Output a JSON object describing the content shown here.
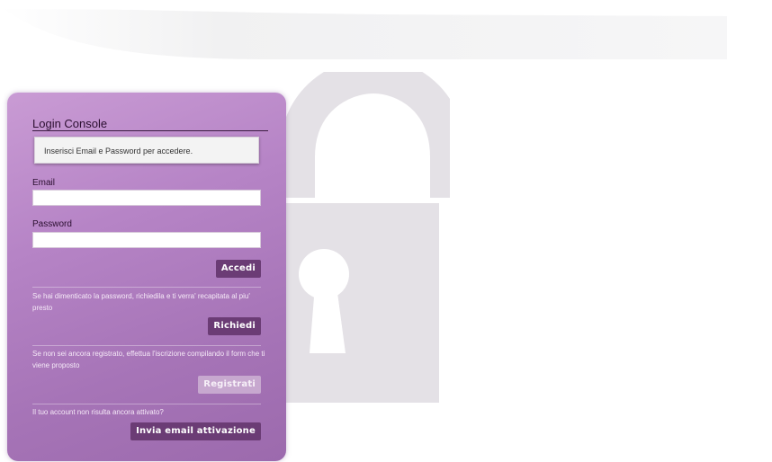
{
  "login": {
    "title": "Login Console",
    "notice": "Inserisci Email e Password per accedere.",
    "email_label": "Email",
    "email_value": "",
    "password_label": "Password",
    "password_value": "",
    "login_button": "Accedi",
    "forgot_text": "Se hai dimenticato la password, richiedila e ti verra' recapitata al piu' presto",
    "request_button": "Richiedi",
    "register_text": "Se non sei ancora registrato, effettua l'iscrizione compilando il form che ti viene proposto",
    "register_button": "Registrati",
    "activation_text": "Il tuo account non risulta ancora attivato?",
    "activation_button": "Invia email attivazione"
  },
  "colors": {
    "panel": "#b684c6",
    "button": "#6b3c75",
    "lock": "#e4e1e6"
  },
  "icons": {
    "background": "padlock-icon"
  }
}
